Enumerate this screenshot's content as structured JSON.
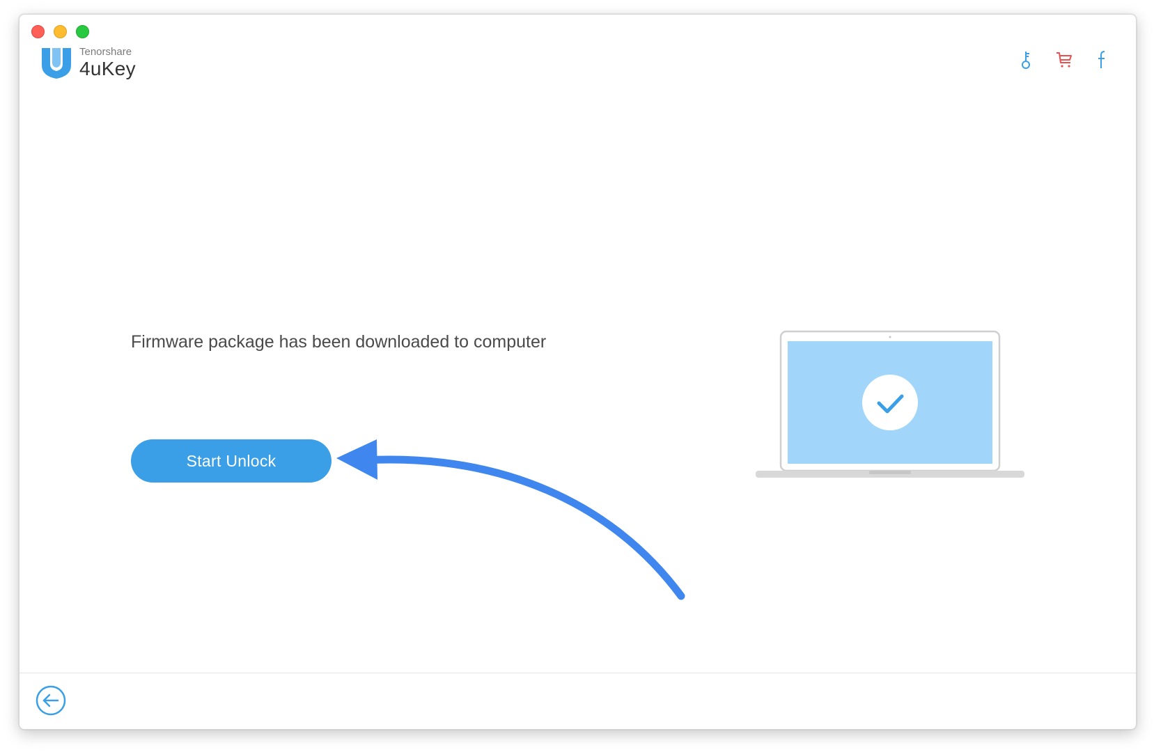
{
  "window": {
    "controls": [
      "close",
      "minimize",
      "maximize"
    ]
  },
  "brand": {
    "company": "Tenorshare",
    "product": "4uKey",
    "logo_icon": "shield-logo-icon"
  },
  "header_icons": [
    {
      "name": "key-icon",
      "color": "#3a9fe6"
    },
    {
      "name": "cart-icon",
      "color": "#e8504f"
    },
    {
      "name": "facebook-icon",
      "color": "#3a9fe6"
    }
  ],
  "main": {
    "status_message": "Firmware package has been downloaded to computer",
    "start_button_label": "Start Unlock",
    "illustration": "laptop-check-icon"
  },
  "footer": {
    "back_icon": "back-arrow-icon"
  },
  "colors": {
    "accent": "#3a9fe6",
    "annotation_arrow": "#3f86ee",
    "laptop_screen": "#a1d6fa",
    "cart": "#e8504f"
  }
}
